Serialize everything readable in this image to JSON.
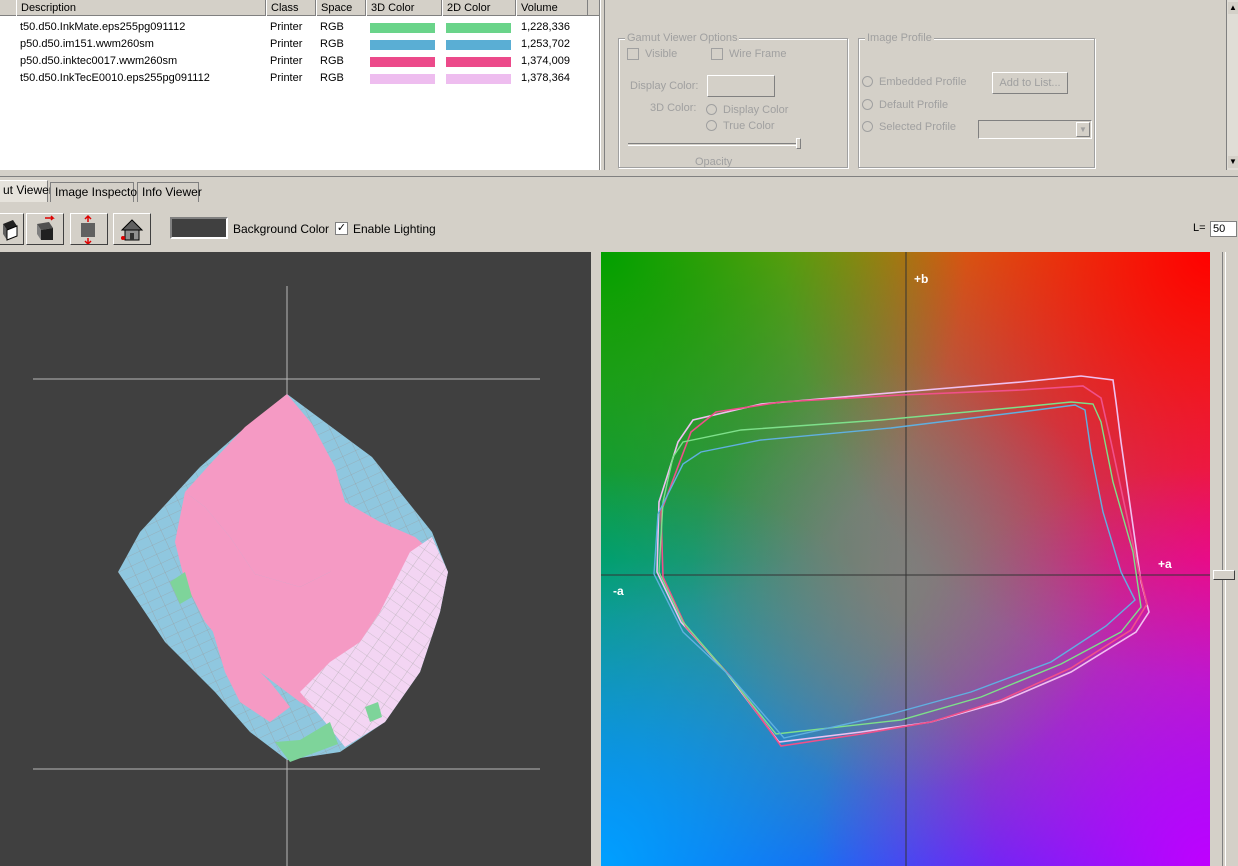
{
  "profile_list": {
    "columns": [
      "Description",
      "Class",
      "Space",
      "3D Color",
      "2D Color",
      "Volume"
    ],
    "rows": [
      {
        "description": "t50.d50.InkMate.eps255pg091112",
        "class": "Printer",
        "space": "RGB",
        "color3d": "#6ad48a",
        "color2d": "#6ad48a",
        "volume": "1,228,336"
      },
      {
        "description": "p50.d50.im151.wwm260sm",
        "class": "Printer",
        "space": "RGB",
        "color3d": "#5aaed4",
        "color2d": "#5aaed4",
        "volume": "1,253,702"
      },
      {
        "description": "p50.d50.inktec0017.wwm260sm",
        "class": "Printer",
        "space": "RGB",
        "color3d": "#ec4a8a",
        "color2d": "#ec4a8a",
        "volume": "1,374,009"
      },
      {
        "description": "t50.d50.InkTecE0010.eps255pg091112",
        "class": "Printer",
        "space": "RGB",
        "color3d": "#eebdef",
        "color2d": "#eebdef",
        "volume": "1,378,364"
      }
    ]
  },
  "gamut_options": {
    "title": "Gamut Viewer Options",
    "visible_label": "Visible",
    "wire_frame_label": "Wire Frame",
    "display_color_label": "Display Color:",
    "color3d_label": "3D Color:",
    "display_color_radio": "Display Color",
    "true_color_radio": "True Color",
    "opacity_label": "Opacity"
  },
  "image_profile": {
    "title": "Image Profile",
    "embedded_label": "Embedded Profile",
    "default_label": "Default Profile",
    "selected_label": "Selected Profile",
    "add_button": "Add to List..."
  },
  "tabs": [
    {
      "label": "ut Viewer",
      "active": true
    },
    {
      "label": "Image Inspector",
      "active": false
    },
    {
      "label": "Info Viewer",
      "active": false
    }
  ],
  "toolbar": {
    "background_color_label": "Background Color",
    "background_color": "#404040",
    "enable_lighting_label": "Enable Lighting",
    "enable_lighting_checked": "✓",
    "l_label": "L=",
    "l_value": "50"
  },
  "plot2d": {
    "axis_plus_b": "+b",
    "axis_plus_a": "+a",
    "axis_minus_a": "-a"
  }
}
